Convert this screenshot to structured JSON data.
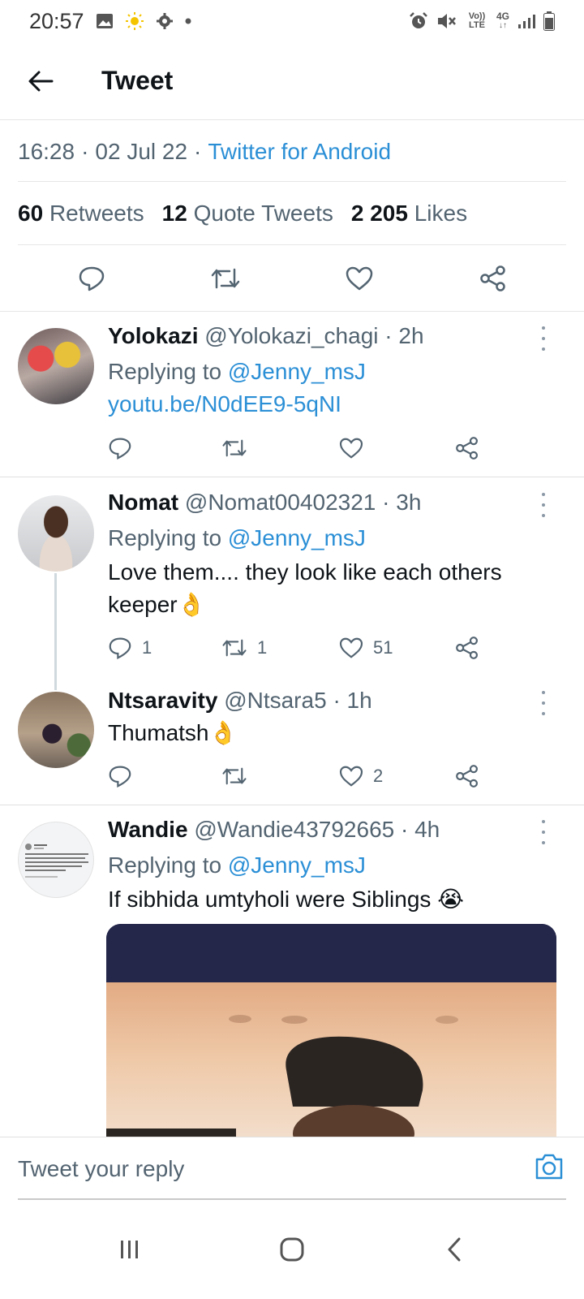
{
  "status_bar": {
    "time": "20:57",
    "left_icons": [
      "image-icon",
      "weather-sun-icon",
      "settings-icon",
      "dot-icon"
    ],
    "right_icons": [
      "alarm-icon",
      "mute-icon",
      "volte-icon",
      "4g-icon",
      "signal-icon",
      "battery-icon"
    ],
    "volte_label": "Vo)) LTE",
    "network_label": "4G"
  },
  "header": {
    "title": "Tweet"
  },
  "meta": {
    "time": "16:28",
    "date": "02 Jul 22",
    "source": "Twitter for Android"
  },
  "stats": {
    "retweets_count": "60",
    "retweets_label": "Retweets",
    "quotes_count": "12",
    "quotes_label": "Quote Tweets",
    "likes_count": "2 205",
    "likes_label": "Likes"
  },
  "replies": [
    {
      "name": "Yolokazi",
      "handle": "@Yolokazi_chagi",
      "time": "2h",
      "replying_prefix": "Replying to",
      "replying_to": "@Jenny_msJ",
      "text": "youtu.be/N0dEE9-5qNI",
      "replies": "",
      "retweets": "",
      "likes": ""
    },
    {
      "name": "Nomat",
      "handle": "@Nomat00402321",
      "time": "3h",
      "replying_prefix": "Replying to",
      "replying_to": "@Jenny_msJ",
      "text": "Love them.... they look like each others keeper👌",
      "replies": "1",
      "retweets": "1",
      "likes": "51"
    },
    {
      "name": "Ntsaravity",
      "handle": "@Ntsara5",
      "time": "1h",
      "text": "Thumatsh👌",
      "replies": "",
      "retweets": "",
      "likes": "2"
    },
    {
      "name": "Wandie",
      "handle": "@Wandie43792665",
      "time": "4h",
      "replying_prefix": "Replying to",
      "replying_to": "@Jenny_msJ",
      "text": "If sibhida umtyholi were Siblings 😭"
    }
  ],
  "reply_bar": {
    "placeholder": "Tweet your reply"
  },
  "nav_bar": {
    "items": [
      "recent-apps-icon",
      "home-icon",
      "back-icon"
    ]
  },
  "colors": {
    "link": "#2b8fd6",
    "text": "#0f1419",
    "muted": "#536471",
    "divider": "#e6e6e6"
  }
}
